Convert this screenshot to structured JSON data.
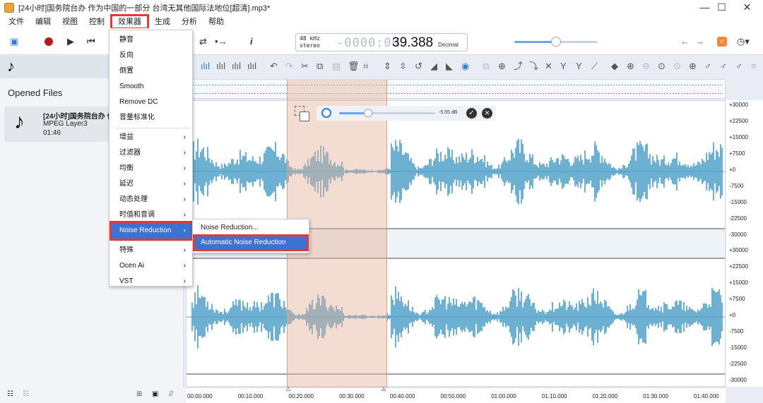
{
  "window": {
    "title": "[24小时]国务院台办 作为中国的一部分 台湾无其他国际法地位[超清].mp3*",
    "minimize": "—",
    "maximize": "☐",
    "close": "✕"
  },
  "menubar": {
    "items": [
      "文件",
      "编辑",
      "视图",
      "控制",
      "效果器",
      "生成",
      "分析",
      "帮助"
    ],
    "highlighted": "效果器"
  },
  "toolbar": {
    "info": "i",
    "display": {
      "sample_rate": "48 kHz",
      "channels": "stereo",
      "dashes": "-0000:00",
      "time": "39.388",
      "format": "Decimal"
    },
    "volume_level": 0.5
  },
  "sidebar": {
    "opened_files_title": "Opened Files",
    "file": {
      "name": "[24小时]国务院台办 作",
      "format": "MPEG Layer3",
      "duration": "01:46"
    }
  },
  "effects_menu": {
    "items": [
      {
        "label": "静音",
        "submenu": false
      },
      {
        "label": "反向",
        "submenu": false
      },
      {
        "label": "倒置",
        "submenu": false
      },
      {
        "label": "Smooth",
        "submenu": false
      },
      {
        "label": "Remove DC",
        "submenu": false
      },
      {
        "label": "音量标准化",
        "submenu": false
      },
      {
        "label": "增益",
        "submenu": true
      },
      {
        "label": "过滤器",
        "submenu": true
      },
      {
        "label": "均衡",
        "submenu": true
      },
      {
        "label": "延迟",
        "submenu": true
      },
      {
        "label": "动态处理",
        "submenu": true
      },
      {
        "label": "时值和音调",
        "submenu": true
      },
      {
        "label": "Noise Reduction",
        "submenu": true
      },
      {
        "label": "特殊",
        "submenu": true
      },
      {
        "label": "Ocen Ai",
        "submenu": true
      },
      {
        "label": "VST",
        "submenu": true
      }
    ],
    "active": "Noise Reduction"
  },
  "noise_submenu": {
    "items": [
      "Noise Reduction...",
      "Automatic Noise Reduction"
    ],
    "active": "Automatic Noise Reduction"
  },
  "volume_popup": {
    "gain": "-5.55 dB",
    "level": 0.3
  },
  "amplitude_scale": {
    "channel1": [
      "+30000",
      "+22500",
      "+15000",
      "+7500",
      "+0",
      "-7500",
      "-15000",
      "-22500",
      "-30000"
    ],
    "channel2": [
      "+30000",
      "+22500",
      "+15000",
      "+7500",
      "+0",
      "-7500",
      "-15000",
      "-22500",
      "-30000"
    ]
  },
  "timeline": {
    "labels": [
      "00:00.000",
      "00:10.000",
      "00:20.000",
      "00:30.000",
      "00:40.000",
      "00:50.000",
      "01:00.000",
      "01:10.000",
      "01:20.000",
      "01:30.000",
      "01:40.000"
    ]
  },
  "colors": {
    "waveform": "#4a9cc7",
    "selection": "#e4b298",
    "menu_active": "#3c72d2",
    "highlight_box": "#e53935"
  }
}
